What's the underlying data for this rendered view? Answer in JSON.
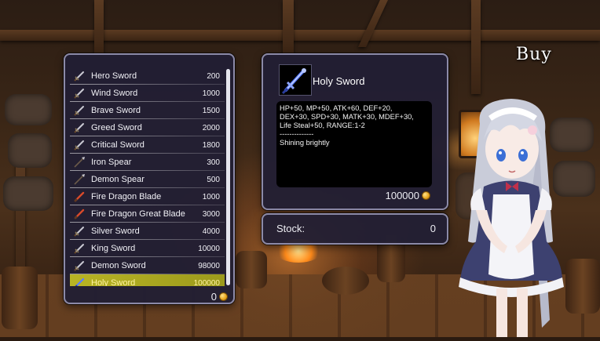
{
  "screen": {
    "title": "Buy"
  },
  "shop_list": {
    "items": [
      {
        "name": "Hero Sword",
        "price": "200",
        "icon": "sword-icon",
        "selected": false
      },
      {
        "name": "Wind Sword",
        "price": "1000",
        "icon": "sword-icon",
        "selected": false
      },
      {
        "name": "Brave Sword",
        "price": "1500",
        "icon": "sword-icon",
        "selected": false
      },
      {
        "name": "Greed Sword",
        "price": "2000",
        "icon": "sword-icon",
        "selected": false
      },
      {
        "name": "Critical Sword",
        "price": "1800",
        "icon": "sword-icon",
        "selected": false
      },
      {
        "name": "Iron Spear",
        "price": "300",
        "icon": "spear-icon",
        "selected": false
      },
      {
        "name": "Demon Spear",
        "price": "500",
        "icon": "spear-icon",
        "selected": false
      },
      {
        "name": "Fire Dragon Blade",
        "price": "1000",
        "icon": "fire-blade-icon",
        "selected": false
      },
      {
        "name": "Fire Dragon Great Blade",
        "price": "3000",
        "icon": "fire-blade-icon",
        "selected": false
      },
      {
        "name": "Silver Sword",
        "price": "4000",
        "icon": "sword-icon",
        "selected": false
      },
      {
        "name": "King Sword",
        "price": "10000",
        "icon": "sword-icon",
        "selected": false
      },
      {
        "name": "Demon Sword",
        "price": "98000",
        "icon": "sword-icon",
        "selected": false
      },
      {
        "name": "Holy Sword",
        "price": "100000",
        "icon": "holy-sword-icon",
        "selected": true
      }
    ],
    "gold": "0"
  },
  "detail": {
    "name": "Holy Sword",
    "icon": "holy-sword-icon",
    "description": "HP+50, MP+50, ATK+60, DEF+20,\nDEX+30, SPD+30, MATK+30, MDEF+30,\nLife Steal+50, RANGE:1-2\n--------------\nShining brightly",
    "price": "100000"
  },
  "stock": {
    "label": "Stock:",
    "value": "0"
  },
  "colors": {
    "highlight": "#b9b424",
    "panel": "#221f34",
    "border": "#8c8aa8",
    "coin": "#e6a219"
  }
}
